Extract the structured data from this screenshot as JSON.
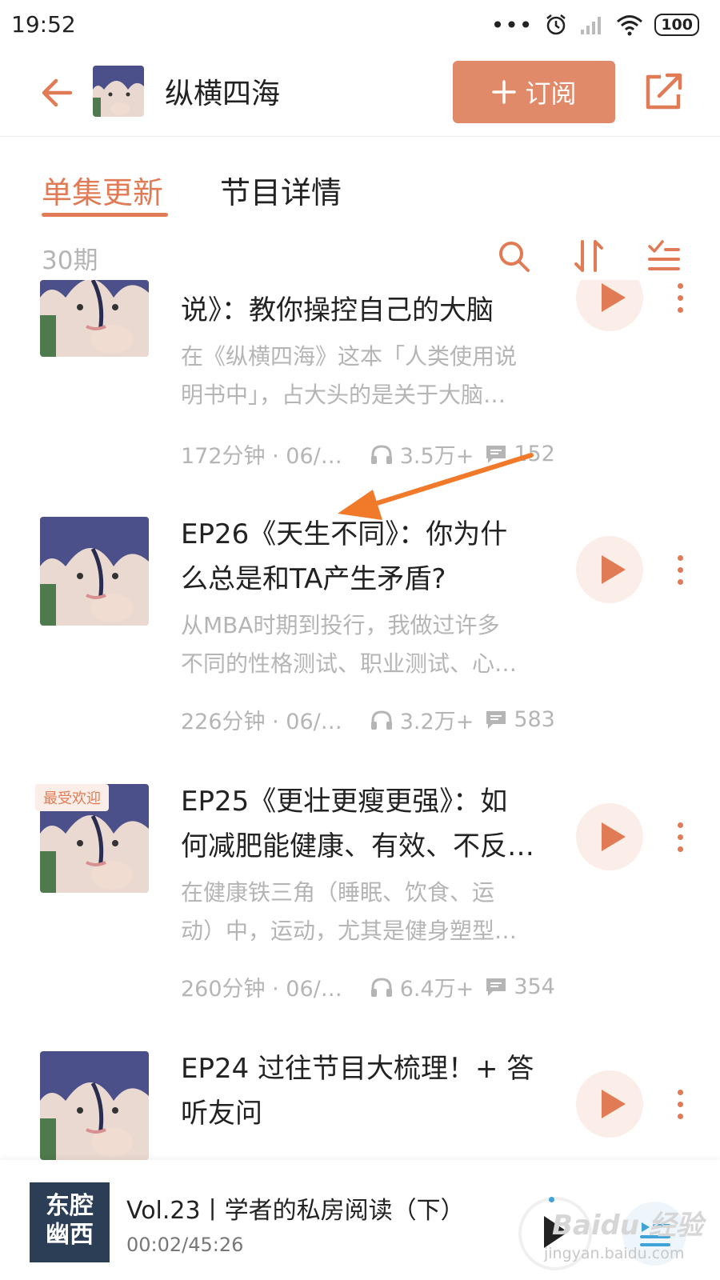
{
  "status_bar": {
    "time": "19:52",
    "battery": "100"
  },
  "header": {
    "podcast_title": "纵横四海",
    "subscribe_label": "订阅"
  },
  "tabs": [
    {
      "label": "单集更新"
    },
    {
      "label": "节目详情"
    }
  ],
  "toolbar": {
    "episode_count": "30期"
  },
  "episodes": [
    {
      "title": "说》：教你操控自己的大脑",
      "desc_line1": "在《纵横四海》这本「人类使用说",
      "desc_line2": "明书中」，占大头的是关于大脑…",
      "duration_date": "172分钟 · 06/…",
      "plays": "3.5万+",
      "comments": "152"
    },
    {
      "title_line1": "EP26《天生不同》：你为什",
      "title_line2": "么总是和TA产生矛盾?",
      "desc_line1": "从MBA时期到投行，我做过许多",
      "desc_line2": "不同的性格测试、职业测试、心…",
      "duration_date": "226分钟 · 06/…",
      "plays": "3.2万+",
      "comments": "583"
    },
    {
      "badge": "最受欢迎",
      "title_line1": "EP25《更壮更瘦更强》：如",
      "title_line2": "何减肥能健康、有效、不反…",
      "desc_line1": "在健康铁三角（睡眠、饮食、运",
      "desc_line2": "动）中，运动，尤其是健身塑型…",
      "duration_date": "260分钟 · 06/…",
      "plays": "6.4万+",
      "comments": "354"
    },
    {
      "title_line1": "EP24 过往节目大梳理！+ 答",
      "title_line2": "听友问"
    }
  ],
  "player": {
    "cover_line1": "东腔",
    "cover_line2": "幽西",
    "title": "Vol.23丨学者的私房阅读（下）",
    "time": "00:02/45:26"
  },
  "watermark": {
    "brand": "Baidu 经验",
    "url": "jingyan.baidu.com"
  },
  "colors": {
    "accent": "#e07b55",
    "subscribe_bg": "#e08a6a",
    "muted_text": "#b5b5b5",
    "annotation_arrow": "#f07a2a"
  },
  "icons": [
    "back-arrow-icon",
    "share-icon",
    "search-icon",
    "sort-icon",
    "filter-list-icon",
    "headphones-icon",
    "comment-icon",
    "play-icon",
    "more-vertical-icon",
    "playlist-icon"
  ]
}
